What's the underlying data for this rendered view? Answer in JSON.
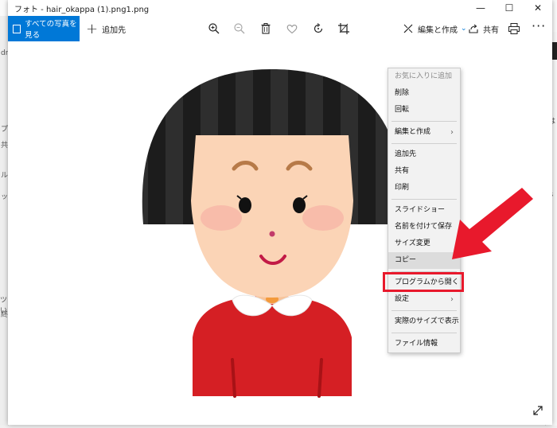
{
  "window": {
    "title": "フォト - hair_okappa (1).png1.png"
  },
  "titlebar": {
    "minimize": "—",
    "maximize": "☐",
    "close": "✕"
  },
  "toolbar": {
    "all_photos": "すべての写真を見る",
    "add_to": "追加先",
    "edit_create": "編集と作成",
    "share": "共有",
    "more": "···"
  },
  "menu": {
    "items": [
      {
        "label": "お気に入りに追加",
        "disabled": true
      },
      {
        "label": "削除"
      },
      {
        "label": "回転"
      },
      {
        "label": "編集と作成",
        "submenu": true
      },
      {
        "label": "追加先"
      },
      {
        "label": "共有"
      },
      {
        "label": "印刷"
      },
      {
        "label": "スライドショー"
      },
      {
        "label": "名前を付けて保存"
      },
      {
        "label": "サイズ変更"
      },
      {
        "label": "コピー",
        "hover": true
      },
      {
        "label": "プログラムから開く",
        "highlighted": true
      },
      {
        "label": "設定",
        "submenu": true
      },
      {
        "label": "実際のサイズで表示"
      },
      {
        "label": "ファイル情報"
      }
    ],
    "chevron": "›"
  },
  "background": {
    "left_texts": [
      "dr",
      "プ",
      "共",
      "ル",
      "ッ",
      "ツい",
      "終"
    ],
    "right_texts": [
      "は",
      "ls"
    ]
  },
  "colors": {
    "accent": "#0078d7",
    "annotation_red": "#e8192c"
  }
}
